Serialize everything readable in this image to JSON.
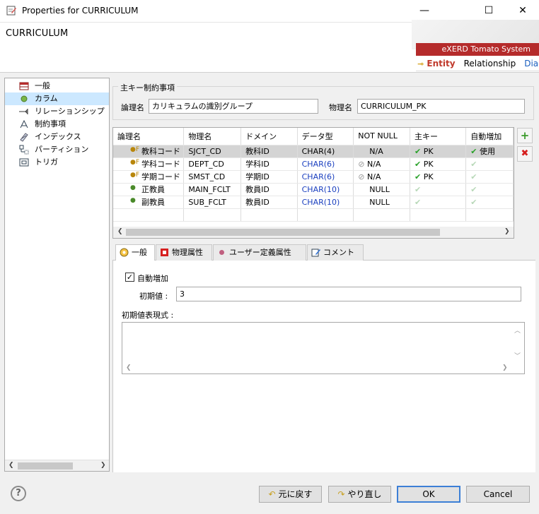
{
  "window": {
    "title": "Properties for CURRICULUM",
    "minimize_glyph": "—",
    "maximize_glyph": "☐",
    "close_glyph": "✕"
  },
  "header": {
    "entity_name": "CURRICULUM",
    "banner_text": "eXERD  Tomato System",
    "tabs": [
      "Entity",
      "Relationship",
      "Diag"
    ]
  },
  "tree": {
    "items": [
      {
        "label": "一般",
        "icon": "table-icon"
      },
      {
        "label": "カラム",
        "icon": "column-icon"
      },
      {
        "label": "リレーションシップ",
        "icon": "relationship-icon"
      },
      {
        "label": "制約事項",
        "icon": "constraint-icon"
      },
      {
        "label": "インデックス",
        "icon": "index-icon"
      },
      {
        "label": "パーティション",
        "icon": "partition-icon"
      },
      {
        "label": "トリガ",
        "icon": "trigger-icon"
      }
    ],
    "selected_index": 1
  },
  "pk_constraint": {
    "group_title": "主キー制約事項",
    "logical_label": "論理名",
    "logical_value": "カリキュラムの識別グループ",
    "physical_label": "物理名",
    "physical_value": "CURRICULUM_PK"
  },
  "grid": {
    "columns": [
      "論理名",
      "物理名",
      "ドメイン",
      "データ型",
      "NOT NULL",
      "主キー",
      "自動増加"
    ],
    "rows": [
      {
        "logical": "教科コード",
        "physical": "SJCT_CD",
        "domain": "教科ID",
        "type": "CHAR(4)",
        "notnull": "N/A",
        "pk": "PK",
        "auto": "使用",
        "selected": true,
        "fk": true
      },
      {
        "logical": "学科コード",
        "physical": "DEPT_CD",
        "domain": "学科ID",
        "type": "CHAR(6)",
        "notnull": "N/A",
        "pk": "PK",
        "auto": "",
        "selected": false,
        "fk": true
      },
      {
        "logical": "学期コード",
        "physical": "SMST_CD",
        "domain": "学期ID",
        "type": "CHAR(6)",
        "notnull": "N/A",
        "pk": "PK",
        "auto": "",
        "selected": false,
        "fk": true
      },
      {
        "logical": "正教員",
        "physical": "MAIN_FCLT",
        "domain": "教員ID",
        "type": "CHAR(10)",
        "notnull": "NULL",
        "pk": "",
        "auto": "",
        "selected": false,
        "fk": false
      },
      {
        "logical": "副教員",
        "physical": "SUB_FCLT",
        "domain": "教員ID",
        "type": "CHAR(10)",
        "notnull": "NULL",
        "pk": "",
        "auto": "",
        "selected": false,
        "fk": false
      }
    ],
    "add_glyph": "+",
    "delete_glyph": "✖"
  },
  "detail_tabs": [
    {
      "label": "一般",
      "icon": "general-icon"
    },
    {
      "label": "物理属性",
      "icon": "physical-icon"
    },
    {
      "label": "ユーザー定義属性",
      "icon": "user-attr-icon"
    },
    {
      "label": "コメント",
      "icon": "comment-icon"
    }
  ],
  "detail": {
    "auto_increment_label": "自動増加",
    "auto_increment_checked": true,
    "initial_label": "初期値 :",
    "initial_value": "3",
    "expr_label": "初期値表現式 :",
    "expr_value": ""
  },
  "buttons": {
    "help": "?",
    "undo": "元に戻す",
    "redo": "やり直し",
    "ok": "OK",
    "cancel": "Cancel"
  },
  "colors": {
    "accent": "#3c7fd6",
    "banner_red": "#b52b2b",
    "entity_tab": "#c0392b",
    "type_blue": "#1a3fbf"
  }
}
